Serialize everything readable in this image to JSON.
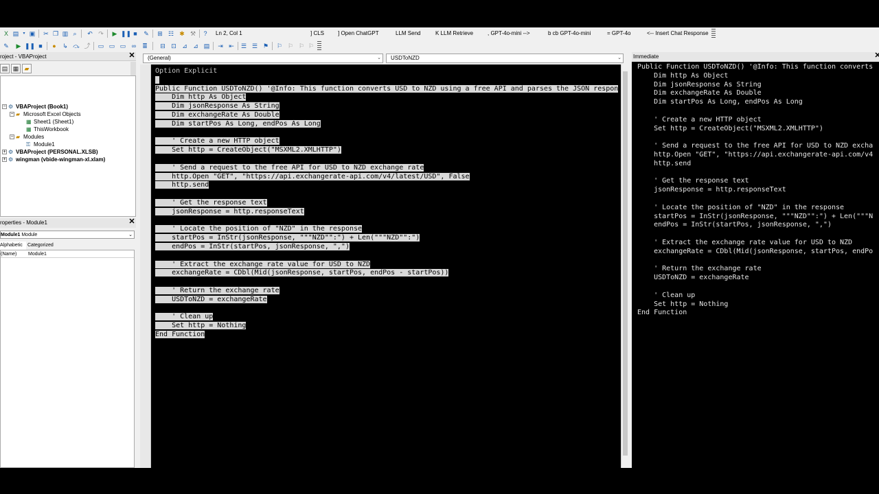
{
  "toolbar": {
    "position_text": "Ln 2, Col 1",
    "custom_buttons": [
      "] CLS",
      "] Open ChatGPT",
      "LLM Send",
      "K LLM Retrieve",
      ", GPT-4o-mini -->",
      "b cb GPT-4o-mini",
      "= GPT-4o",
      "<-- Insert Chat Response"
    ]
  },
  "project": {
    "title": "roject - VBAProject",
    "tree": [
      {
        "label": "VBAProject (Book1)",
        "bold": true
      },
      {
        "label": "Microsoft Excel Objects",
        "bold": false
      },
      {
        "label": "Sheet1 (Sheet1)",
        "bold": false
      },
      {
        "label": "ThisWorkbook",
        "bold": false
      },
      {
        "label": "Modules",
        "bold": false
      },
      {
        "label": "Module1",
        "bold": false
      },
      {
        "label": "VBAProject (PERSONAL.XLSB)",
        "bold": true
      },
      {
        "label": "wingman (vbide-wingman-xl.xlam)",
        "bold": true
      }
    ]
  },
  "properties": {
    "title": "roperties - Module1",
    "object_name": "Module1",
    "object_type": "Module",
    "tabs": [
      "Alphabetic",
      "Categorized"
    ],
    "rows": [
      {
        "name": "(Name)",
        "value": "Module1"
      }
    ]
  },
  "code": {
    "object_combo": "(General)",
    "procedure_combo": "USDToNZD",
    "lines": [
      {
        "text": "Option Explicit",
        "selected": false
      },
      {
        "text": " ",
        "selected": true
      },
      {
        "text": "Public Function USDToNZD() '@Info: This function converts USD to NZD using a free API and parses the JSON respon",
        "selected": true
      },
      {
        "text": "    Dim http As Object",
        "selected": true
      },
      {
        "text": "    Dim jsonResponse As String",
        "selected": true
      },
      {
        "text": "    Dim exchangeRate As Double",
        "selected": true
      },
      {
        "text": "    Dim startPos As Long, endPos As Long",
        "selected": true
      },
      {
        "text": "",
        "selected": true
      },
      {
        "text": "    ' Create a new HTTP object",
        "selected": true
      },
      {
        "text": "    Set http = CreateObject(\"MSXML2.XMLHTTP\")",
        "selected": true
      },
      {
        "text": "",
        "selected": true
      },
      {
        "text": "    ' Send a request to the free API for USD to NZD exchange rate",
        "selected": true
      },
      {
        "text": "    http.Open \"GET\", \"https://api.exchangerate-api.com/v4/latest/USD\", False",
        "selected": true
      },
      {
        "text": "    http.send",
        "selected": true
      },
      {
        "text": "",
        "selected": true
      },
      {
        "text": "    ' Get the response text",
        "selected": true
      },
      {
        "text": "    jsonResponse = http.responseText",
        "selected": true
      },
      {
        "text": "",
        "selected": true
      },
      {
        "text": "    ' Locate the position of \"NZD\" in the response",
        "selected": true
      },
      {
        "text": "    startPos = InStr(jsonResponse, \"\"\"NZD\"\":\") + Len(\"\"\"NZD\"\":\")",
        "selected": true
      },
      {
        "text": "    endPos = InStr(startPos, jsonResponse, \",\")",
        "selected": true
      },
      {
        "text": "",
        "selected": true
      },
      {
        "text": "    ' Extract the exchange rate value for USD to NZD",
        "selected": true
      },
      {
        "text": "    exchangeRate = CDbl(Mid(jsonResponse, startPos, endPos - startPos))",
        "selected": true
      },
      {
        "text": "",
        "selected": true
      },
      {
        "text": "    ' Return the exchange rate",
        "selected": true
      },
      {
        "text": "    USDToNZD = exchangeRate",
        "selected": true
      },
      {
        "text": "",
        "selected": true
      },
      {
        "text": "    ' Clean up",
        "selected": true
      },
      {
        "text": "    Set http = Nothing",
        "selected": true
      },
      {
        "text": "End Function",
        "selected": true
      }
    ]
  },
  "immediate": {
    "title": "Immediate",
    "lines": [
      "Public Function USDToNZD() '@Info: This function converts",
      "    Dim http As Object",
      "    Dim jsonResponse As String",
      "    Dim exchangeRate As Double",
      "    Dim startPos As Long, endPos As Long",
      "",
      "    ' Create a new HTTP object",
      "    Set http = CreateObject(\"MSXML2.XMLHTTP\")",
      "",
      "    ' Send a request to the free API for USD to NZD excha",
      "    http.Open \"GET\", \"https://api.exchangerate-api.com/v4",
      "    http.send",
      "",
      "    ' Get the response text",
      "    jsonResponse = http.responseText",
      "",
      "    ' Locate the position of \"NZD\" in the response",
      "    startPos = InStr(jsonResponse, \"\"\"NZD\"\":\") + Len(\"\"\"N",
      "    endPos = InStr(startPos, jsonResponse, \",\")",
      "",
      "    ' Extract the exchange rate value for USD to NZD",
      "    exchangeRate = CDbl(Mid(jsonResponse, startPos, endPo",
      "",
      "    ' Return the exchange rate",
      "    USDToNZD = exchangeRate",
      "",
      "    ' Clean up",
      "    Set http = Nothing",
      "End Function"
    ]
  }
}
